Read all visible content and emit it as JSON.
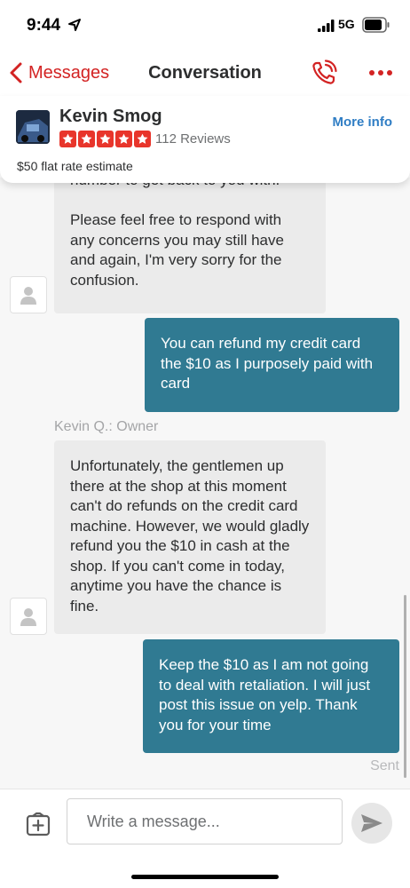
{
  "status": {
    "time": "9:44",
    "network": "5G"
  },
  "nav": {
    "back_label": "Messages",
    "title": "Conversation"
  },
  "business": {
    "name": "Kevin Smog",
    "reviews": "112 Reviews",
    "rating": 5,
    "more_info": "More info",
    "estimate": "$50 flat rate estimate"
  },
  "messages": [
    {
      "direction": "incoming",
      "text": "number to get back to you with.\n\nPlease feel free to respond with any concerns you may still have and again, I'm very sorry for the confusion."
    },
    {
      "direction": "outgoing",
      "text": "You can refund my credit card the $10 as I purposely paid with card"
    },
    {
      "direction": "incoming",
      "sender": "Kevin Q.: Owner",
      "text": "Unfortunately, the gentlemen up there at the shop at this moment can't do refunds on the credit card machine. However, we would gladly refund you the $10 in cash at the shop. If you can't come in today, anytime you have the chance is fine."
    },
    {
      "direction": "outgoing",
      "text": "Keep the $10 as I am not going to deal with retaliation. I will just post this issue on yelp. Thank you for your time",
      "status": "Sent"
    }
  ],
  "composer": {
    "placeholder": "Write a message..."
  },
  "colors": {
    "brand_red": "#d32323",
    "star_red": "#e8352b",
    "outgoing_bubble": "#307a92",
    "incoming_bubble": "#ebebeb",
    "link_blue": "#2f7dc4"
  },
  "icons": [
    "location-arrow-icon",
    "signal-icon",
    "battery-icon",
    "chevron-left-icon",
    "phone-icon",
    "more-dots-icon",
    "star-icon",
    "user-icon",
    "add-attachment-icon",
    "send-icon"
  ]
}
